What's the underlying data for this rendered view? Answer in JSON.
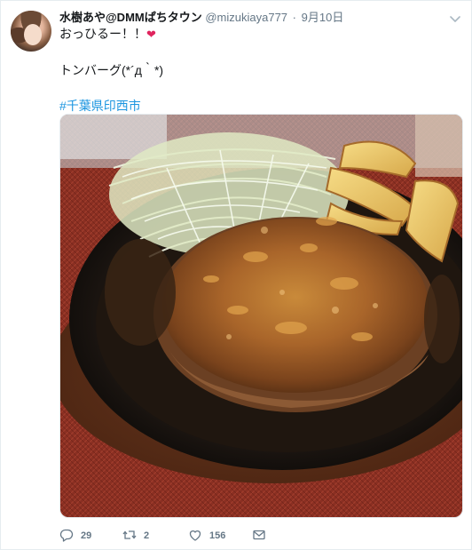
{
  "tweet": {
    "display_name": "水樹あや@DMMぱちタウン",
    "handle": "@mizukiaya777",
    "separator": "·",
    "date": "9月10日",
    "text_line1": "おっひるー！！",
    "text_line2": "トンバーグ(*´д｀*)",
    "hashtag": "#千葉県印西市",
    "photo_description_icon": "photo"
  },
  "actions": {
    "reply_count": "29",
    "retweet_count": "2",
    "like_count": "156"
  },
  "icons": {
    "heart_emoji": "❤",
    "reply": "reply-icon",
    "retweet": "retweet-icon",
    "like": "like-icon",
    "dm": "dm-icon",
    "more": "chevron-down-icon"
  },
  "colors": {
    "link": "#1b95e0",
    "secondary_text": "#657786",
    "heart": "#e0245e"
  }
}
